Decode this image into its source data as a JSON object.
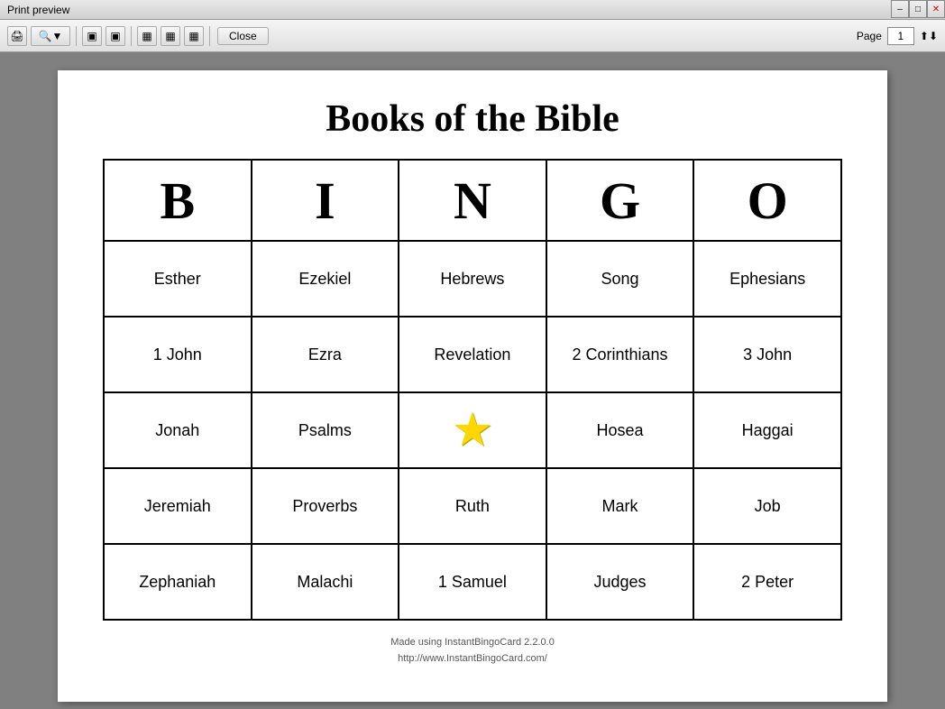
{
  "window": {
    "title": "Print preview",
    "close_btn": "Close",
    "page_label": "Page",
    "page_number": "1"
  },
  "toolbar": {
    "icons": [
      "🖨",
      "🔍",
      "▣",
      "▣",
      "▦",
      "▦",
      "▦"
    ],
    "close": "Close"
  },
  "card": {
    "title": "Books of the Bible",
    "bingo_letters": [
      "B",
      "I",
      "N",
      "G",
      "O"
    ],
    "rows": [
      [
        "Esther",
        "Ezekiel",
        "Hebrews",
        "Song",
        "Ephesians"
      ],
      [
        "1 John",
        "Ezra",
        "Revelation",
        "2 Corinthians",
        "3 John"
      ],
      [
        "Jonah",
        "Psalms",
        "★",
        "Hosea",
        "Haggai"
      ],
      [
        "Jeremiah",
        "Proverbs",
        "Ruth",
        "Mark",
        "Job"
      ],
      [
        "Zephaniah",
        "Malachi",
        "1 Samuel",
        "Judges",
        "2 Peter"
      ]
    ],
    "footer_line1": "Made using InstantBingoCard 2.2.0.0",
    "footer_line2": "http://www.InstantBingoCard.com/"
  }
}
